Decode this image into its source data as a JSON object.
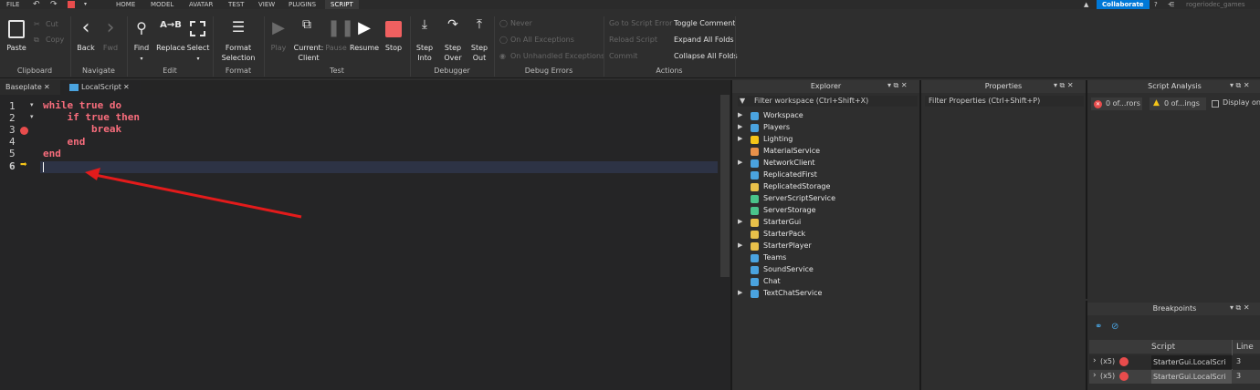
{
  "menubar": {
    "items": [
      "FILE",
      "HOME",
      "MODEL",
      "AVATAR",
      "TEST",
      "VIEW",
      "PLUGINS",
      "SCRIPT"
    ],
    "collaborate": "Collaborate",
    "user": "rogeriodec_games"
  },
  "ribbon": {
    "clipboard": {
      "paste": "Paste",
      "cut": "Cut",
      "copy": "Copy",
      "group": "Clipboard"
    },
    "navigate": {
      "back": "Back",
      "fwd": "Fwd",
      "group": "Navigate"
    },
    "edit": {
      "find": "Find",
      "replace": "Replace",
      "select": "Select",
      "group": "Edit"
    },
    "format": {
      "format1": "Format",
      "format2": "Selection",
      "group": "Format"
    },
    "test": {
      "play": "Play",
      "current1": "Current:",
      "current2": "Client",
      "pause": "Pause",
      "resume": "Resume",
      "stop": "Stop",
      "group": "Test"
    },
    "debugger": {
      "into1": "Step",
      "into2": "Into",
      "over1": "Step",
      "over2": "Over",
      "out1": "Step",
      "out2": "Out",
      "group": "Debugger"
    },
    "debug_errors": {
      "never": "Never",
      "all": "On All Exceptions",
      "unhandled": "On Unhandled Exceptions",
      "group": "Debug Errors"
    },
    "actions": {
      "goto": "Go to Script Error",
      "reload": "Reload Script",
      "commit": "Commit",
      "toggle": "Toggle Comment",
      "expand": "Expand All Folds",
      "collapse": "Collapse All Folds",
      "group": "Actions"
    }
  },
  "tabs": [
    {
      "label": "Baseplate"
    },
    {
      "label": "LocalScript"
    }
  ],
  "editor": {
    "lines": [
      "while true do",
      "    if true then",
      "        break",
      "    end",
      "end",
      ""
    ],
    "line_numbers": [
      "1",
      "2",
      "3",
      "4",
      "5",
      "6"
    ]
  },
  "explorer": {
    "title": "Explorer",
    "filter": "Filter workspace (Ctrl+Shift+X)",
    "items": [
      "Workspace",
      "Players",
      "Lighting",
      "MaterialService",
      "NetworkClient",
      "ReplicatedFirst",
      "ReplicatedStorage",
      "ServerScriptService",
      "ServerStorage",
      "StarterGui",
      "StarterPack",
      "StarterPlayer",
      "Teams",
      "SoundService",
      "Chat",
      "TextChatService"
    ]
  },
  "properties": {
    "title": "Properties",
    "filter": "Filter Properties (Ctrl+Shift+P)"
  },
  "script_analysis": {
    "title": "Script Analysis",
    "errors": "0 of...rors",
    "warnings": "0 of...ings",
    "display": "Display only"
  },
  "breakpoints": {
    "title": "Breakpoints",
    "col_script": "Script",
    "col_line": "Line",
    "rows": [
      {
        "count": "(x5)",
        "script": "StarterGui.LocalScri",
        "line": "3"
      },
      {
        "count": "(x5)",
        "script": "StarterGui.LocalScri",
        "line": "3"
      }
    ]
  },
  "colors": {
    "accent": "#0078d7",
    "breakpoint": "#e84c4c",
    "keyword": "#f86d7c",
    "arrow": "#e31b1b"
  }
}
